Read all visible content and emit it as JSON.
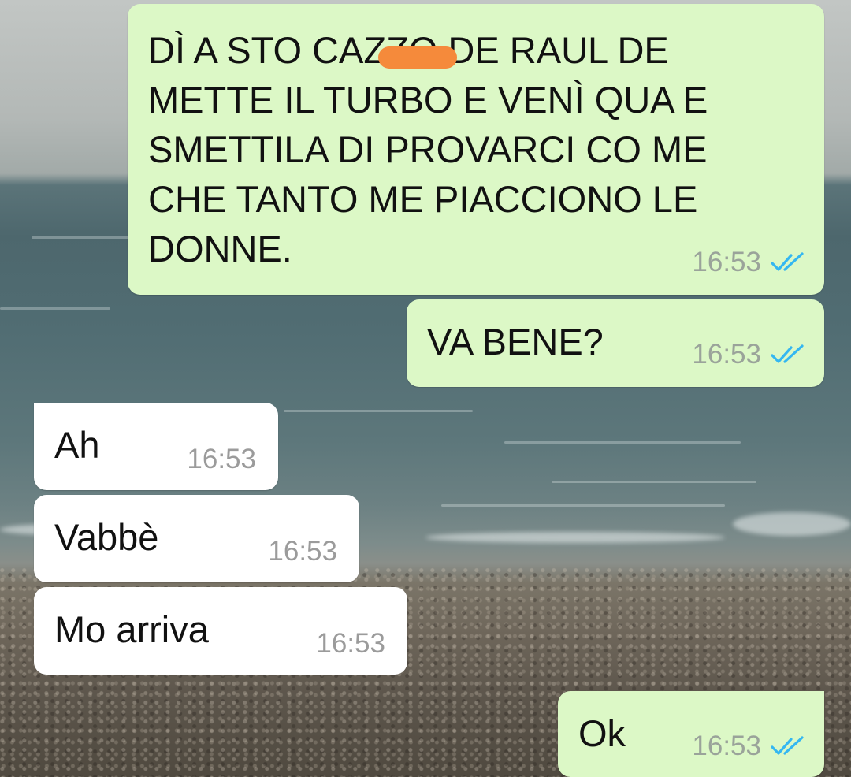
{
  "colors": {
    "outgoing_bubble": "#dcf8c6",
    "incoming_bubble": "#ffffff",
    "read_ticks": "#34b7f1",
    "redaction_mark": "#f58a3b"
  },
  "messages": [
    {
      "direction": "outgoing",
      "text": "DÌ A STO CAZZO DE RAUL DE\nMETTE IL TURBO E VENÌ QUA E\nSMETTILA DI PROVARCI CO ME\nCHE TANTO ME PIACCIONO LE\nDONNE.",
      "time": "16:53",
      "status_icon": "double-check-read-icon"
    },
    {
      "direction": "outgoing",
      "text": "VA BENE?",
      "time": "16:53",
      "status_icon": "double-check-read-icon"
    },
    {
      "direction": "incoming",
      "text": "Ah",
      "time": "16:53"
    },
    {
      "direction": "incoming",
      "text": "Vabbè",
      "time": "16:53"
    },
    {
      "direction": "incoming",
      "text": "Mo arriva",
      "time": "16:53"
    },
    {
      "direction": "outgoing",
      "text": "Ok",
      "time": "16:53",
      "status_icon": "double-check-read-icon"
    }
  ]
}
